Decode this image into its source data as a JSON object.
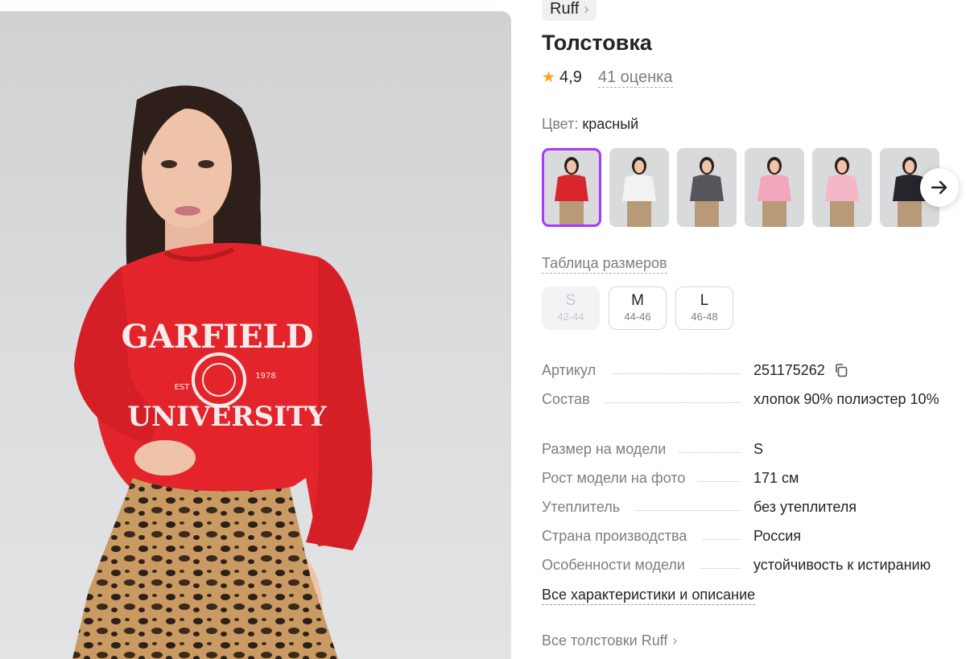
{
  "brand": {
    "name": "Ruff"
  },
  "product": {
    "title": "Толстовка",
    "rating": "4,9",
    "reviews": "41 оценка"
  },
  "color": {
    "label": "Цвет:",
    "value": "красный"
  },
  "variants": [
    {
      "name": "red-garfield",
      "color": "#d8262c",
      "selected": true
    },
    {
      "name": "white-garfield",
      "color": "#f2f2f2",
      "selected": false
    },
    {
      "name": "graphite-garfield",
      "color": "#55565c",
      "selected": false
    },
    {
      "name": "pink-plain",
      "color": "#f2a5bb",
      "selected": false
    },
    {
      "name": "pink-skirt",
      "color": "#f5b7c8",
      "selected": false
    },
    {
      "name": "black-garfield",
      "color": "#25252b",
      "selected": false
    }
  ],
  "size_table": {
    "label": "Таблица размеров"
  },
  "sizes": [
    {
      "label": "S",
      "range": "42-44",
      "available": false
    },
    {
      "label": "M",
      "range": "44-46",
      "available": true
    },
    {
      "label": "L",
      "range": "46-48",
      "available": true
    }
  ],
  "specs": {
    "article": {
      "key": "Артикул",
      "value": "251175262"
    },
    "composition": {
      "key": "Состав",
      "value": "хлопок 90% полиэстер 10%"
    },
    "model_size": {
      "key": "Размер на модели",
      "value": "S"
    },
    "model_height": {
      "key": "Рост модели на фото",
      "value": "171 см"
    },
    "insulation": {
      "key": "Утеплитель",
      "value": "без утеплителя"
    },
    "country": {
      "key": "Страна производства",
      "value": "Россия"
    },
    "features": {
      "key": "Особенности модели",
      "value": "устойчивость к истиранию"
    }
  },
  "links": {
    "all_chars": "Все характеристики и описание",
    "all_brand": "Все толстовки Ruff"
  },
  "photo_print": {
    "line1": "GARFIELD",
    "line2": "UNIVERSITY",
    "est": "EST",
    "year": "1978"
  },
  "colors": {
    "accent": "#a73afd",
    "star": "#ffa31a",
    "sweater": "#e3242b"
  }
}
